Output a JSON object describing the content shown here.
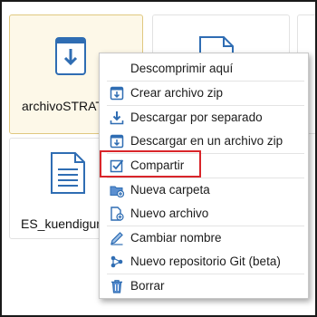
{
  "files": [
    {
      "name": "archivoSTRATO",
      "type": "zip-archive",
      "selected": true
    },
    {
      "name": "ES_kuendigung",
      "type": "document"
    }
  ],
  "context_menu": {
    "items": [
      {
        "label": "Descomprimir aquí",
        "icon": "none"
      },
      {
        "label": "Crear archivo zip",
        "icon": "zip-archive-icon"
      },
      {
        "label": "Descargar por separado",
        "icon": "download-icon"
      },
      {
        "label": "Descargar en un archivo zip",
        "icon": "zip-download-icon"
      },
      {
        "label": "Compartir",
        "icon": "checkbox-check-icon",
        "highlighted": true
      },
      {
        "label": "Nueva carpeta",
        "icon": "new-folder-icon"
      },
      {
        "label": "Nuevo archivo",
        "icon": "new-file-icon"
      },
      {
        "label": "Cambiar nombre",
        "icon": "pen-icon"
      },
      {
        "label": "Nuevo repositorio Git (beta)",
        "icon": "git-icon"
      },
      {
        "label": "Borrar",
        "icon": "trash-icon"
      }
    ]
  },
  "colors": {
    "accent_blue": "#2f6db3",
    "highlight_red": "#d9252a",
    "selected_tile": "#fdf8e8"
  }
}
